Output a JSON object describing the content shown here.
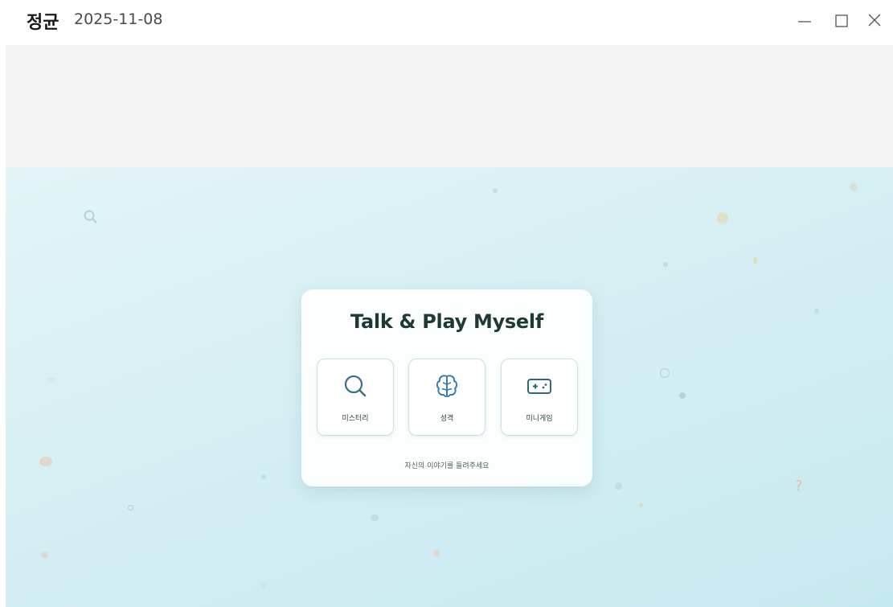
{
  "window": {
    "title_name": "정균",
    "title_date": "2025-11-08",
    "controls": {
      "minimize_icon": "minimize-icon",
      "maximize_icon": "maximize-icon",
      "close_icon": "close-icon"
    }
  },
  "card": {
    "title": "Talk & Play Myself",
    "subtitle": "자신의 이야기를 들려주세요",
    "tiles": [
      {
        "label": "미스터리",
        "icon": "search-icon"
      },
      {
        "label": "성격",
        "icon": "brain-icon"
      },
      {
        "label": "미니게임",
        "icon": "gamepad-icon"
      }
    ]
  },
  "decorations": [
    "?"
  ],
  "colors": {
    "accent": "#3a6f86",
    "title_text": "#1f3a36",
    "background_top": "#e3f4f7",
    "background_bottom": "#c6e9ef",
    "header_band": "#f3f3f3"
  }
}
